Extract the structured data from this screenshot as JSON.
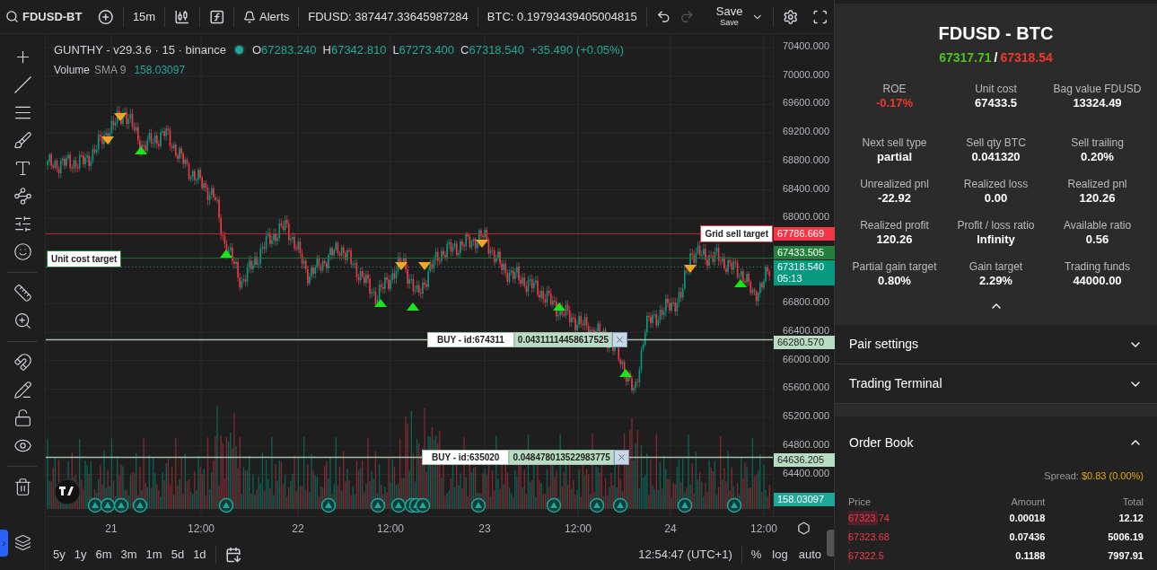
{
  "toolbar": {
    "symbol": "FDUSD-BT",
    "interval": "15m",
    "alerts": "Alerts",
    "balances": [
      "FDUSD: 387447.33645987284",
      "BTC: 0.19793439405004815"
    ],
    "redo_disabled": true,
    "save": "Save",
    "save_caption": "Save"
  },
  "legend": {
    "title": "GUNTHY - v29.3.6 · 15 · binance",
    "ohlc": [
      {
        "label": "O",
        "value": "67283.240"
      },
      {
        "label": "H",
        "value": "67342.810"
      },
      {
        "label": "L",
        "value": "67273.400"
      },
      {
        "label": "C",
        "value": "67318.540"
      }
    ],
    "change": "+35.490 (+0.05%)",
    "volume": {
      "label": "Volume",
      "indicator": "SMA 9",
      "value": "158.03097"
    }
  },
  "price_axis": [
    "70400.000",
    "70000.000",
    "69600.000",
    "69200.000",
    "68800.000",
    "68400.000",
    "68000.000",
    "66800.000",
    "66400.000",
    "66000.000",
    "65600.000",
    "65200.000",
    "64800.000",
    "64400.000"
  ],
  "targets": [
    {
      "kind": "grid_sell",
      "label": "Grid sell target",
      "price": "67786.669"
    },
    {
      "kind": "unit_cost",
      "label": "Unit cost target",
      "price": "67433.505"
    }
  ],
  "last_price": {
    "price": "67318.540",
    "countdown": "05:13"
  },
  "orders": [
    {
      "label": "BUY - id:674311",
      "amount": "0.04311114458617525",
      "price": "66280.570"
    },
    {
      "label": "BUY - id:635020",
      "amount": "0.048478013522983775",
      "price": "64636.205"
    }
  ],
  "volume_price": "158.03097",
  "time_axis": [
    "21",
    "12:00",
    "22",
    "12:00",
    "23",
    "12:00",
    "24",
    "12:00"
  ],
  "ranges": [
    "5y",
    "1y",
    "6m",
    "3m",
    "1m",
    "5d",
    "1d"
  ],
  "clock": "12:54:47 (UTC+1)",
  "scale_options": [
    "%",
    "log",
    "auto"
  ],
  "panel": {
    "pair": "FDUSD - BTC",
    "bid": "67317.71",
    "separator": "/",
    "ask": "67318.54",
    "stats": [
      {
        "label": "ROE",
        "value": "-0.17%",
        "negative": true
      },
      {
        "label": "Unit cost",
        "value": "67433.5",
        "negative": false
      },
      {
        "label": "Bag value FDUSD",
        "value": "13324.49",
        "negative": false
      },
      {
        "label": "Next sell type",
        "value": "partial",
        "negative": false
      },
      {
        "label": "Sell qty BTC",
        "value": "0.041320",
        "negative": false
      },
      {
        "label": "Sell trailing",
        "value": "0.20%",
        "negative": false
      },
      {
        "label": "Unrealized pnl",
        "value": "-22.92",
        "negative": false
      },
      {
        "label": "Realized loss",
        "value": "0.00",
        "negative": false
      },
      {
        "label": "Realized pnl",
        "value": "120.26",
        "negative": false
      },
      {
        "label": "Realized profit",
        "value": "120.26",
        "negative": false
      },
      {
        "label": "Profit / loss ratio",
        "value": "Infinity",
        "negative": false
      },
      {
        "label": "Available ratio",
        "value": "0.56",
        "negative": false
      },
      {
        "label": "Partial gain target",
        "value": "0.80%",
        "negative": false
      },
      {
        "label": "Gain target",
        "value": "2.29%",
        "negative": false
      },
      {
        "label": "Trading funds",
        "value": "44000.00",
        "negative": false
      }
    ],
    "stats_expanded": true,
    "sections": [
      {
        "title": "Pair settings",
        "expanded": false
      },
      {
        "title": "Trading Terminal",
        "expanded": false
      }
    ],
    "order_book": {
      "title": "Order Book",
      "expanded": true,
      "spread_label": "Spread:",
      "spread_value": "$0.83 (0.00%)",
      "columns": [
        "Price",
        "Amount",
        "Total"
      ],
      "rows": [
        {
          "price": "67323.74",
          "amount": "0.00018",
          "total": "12.12"
        },
        {
          "price": "67323.68",
          "amount": "0.07436",
          "total": "5006.19"
        },
        {
          "price": "67322.5",
          "amount": "0.1188",
          "total": "7997.91"
        }
      ]
    }
  }
}
